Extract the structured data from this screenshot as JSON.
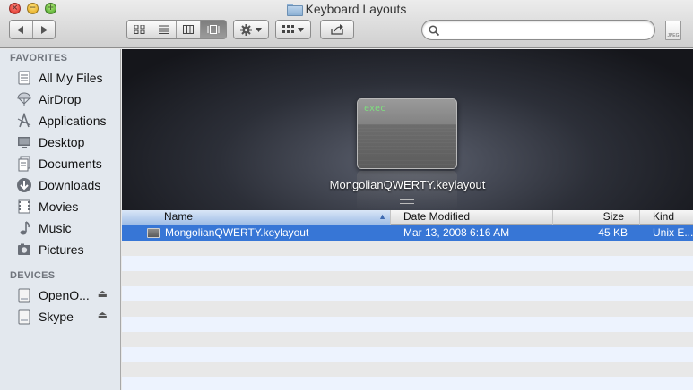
{
  "window": {
    "title": "Keyboard Layouts"
  },
  "toolbar": {
    "search_placeholder": "",
    "action_icon": "gear-icon",
    "arrange_icon": "grid-icon",
    "share_icon": "share-icon",
    "view_active": "coverflow"
  },
  "sidebar": {
    "favorites_header": "FAVORITES",
    "favorites": [
      {
        "label": "All My Files",
        "icon": "all-files-icon"
      },
      {
        "label": "AirDrop",
        "icon": "airdrop-icon"
      },
      {
        "label": "Applications",
        "icon": "applications-icon"
      },
      {
        "label": "Desktop",
        "icon": "desktop-icon"
      },
      {
        "label": "Documents",
        "icon": "documents-icon"
      },
      {
        "label": "Downloads",
        "icon": "downloads-icon"
      },
      {
        "label": "Movies",
        "icon": "movies-icon"
      },
      {
        "label": "Music",
        "icon": "music-icon"
      },
      {
        "label": "Pictures",
        "icon": "pictures-icon"
      }
    ],
    "devices_header": "DEVICES",
    "devices": [
      {
        "label": "OpenO...",
        "icon": "disk-icon"
      },
      {
        "label": "Skype",
        "icon": "disk-icon"
      }
    ]
  },
  "coverflow": {
    "file_badge": "exec",
    "file_name": "MongolianQWERTY.keylayout"
  },
  "list": {
    "columns": [
      "Name",
      "Date Modified",
      "Size",
      "Kind"
    ],
    "sorted_column": "Name",
    "rows": [
      {
        "name": "MongolianQWERTY.keylayout",
        "date": "Mar 13, 2008 6:16 AM",
        "size": "45 KB",
        "kind": "Unix E..."
      }
    ]
  },
  "jpeg_badge": "JPEG"
}
